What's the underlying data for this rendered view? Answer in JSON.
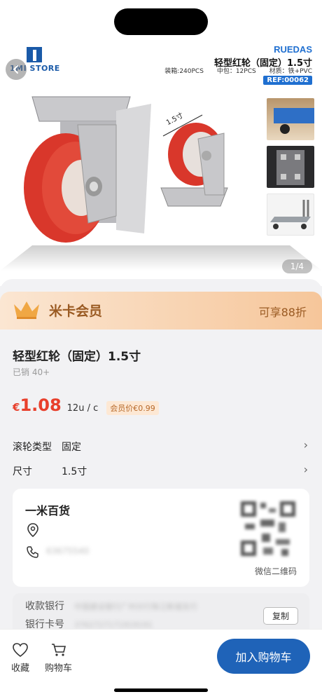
{
  "product_image": {
    "logo_text": "1MI STORE",
    "brand": "RUEDAS",
    "title": "轻型红轮（固定）1.5寸",
    "specs": [
      "装箱:240PCS",
      "中包：12PCS",
      "材质：铁+PVC"
    ],
    "ref": "REF:00062",
    "dimension_label": "1.5寸",
    "pager": "1/4"
  },
  "member": {
    "title": "米卡会员",
    "offer": "可享88折"
  },
  "product": {
    "name": "轻型红轮（固定）1.5寸",
    "sold": "已销 40+",
    "currency": "€",
    "price": "1.08",
    "unit": "12u / c",
    "vip_price": "会员价€0.99"
  },
  "attributes": [
    {
      "key": "滚轮类型",
      "value": "固定"
    },
    {
      "key": "尺寸",
      "value": "1.5寸"
    }
  ],
  "shop": {
    "name": "一米百货",
    "phone": "63675540",
    "qr_label": "微信二维码"
  },
  "bank": {
    "bank_label": "收款银行",
    "bank_value": "中国建设银行广州分行珠江新城支行",
    "account_label": "银行卡号",
    "account_value": "3762727171919191",
    "copy_label": "复制"
  },
  "bottom_bar": {
    "fav_label": "收藏",
    "cart_label": "购物车",
    "add_to_cart": "加入购物车"
  },
  "colors": {
    "accent_blue": "#1f63b8",
    "price_red": "#e8402c",
    "member_gold": "#9a5a22"
  }
}
